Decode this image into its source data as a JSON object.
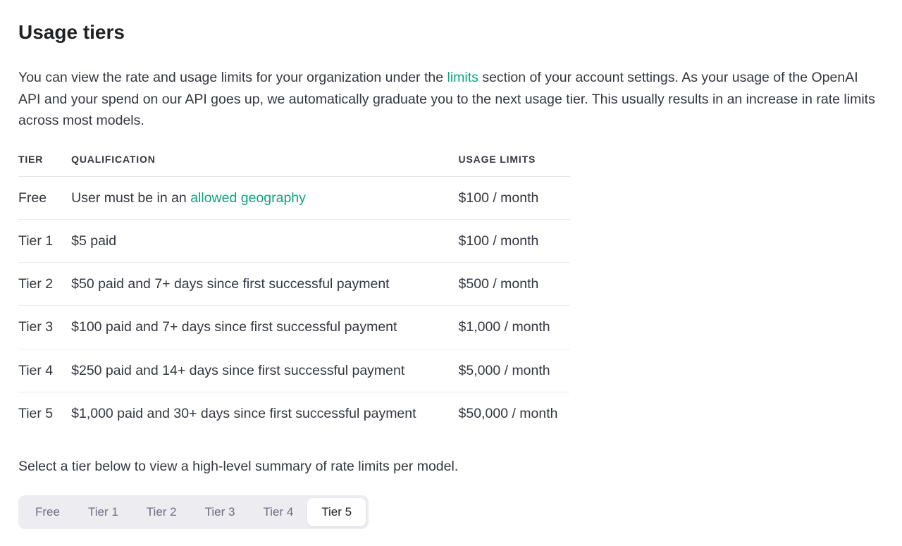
{
  "heading": "Usage tiers",
  "intro": {
    "pre_link": "You can view the rate and usage limits for your organization under the ",
    "link_text": "limits",
    "post_link": " section of your account settings. As your usage of the OpenAI API and your spend on our API goes up, we automatically graduate you to the next usage tier. This usually results in an increase in rate limits across most models."
  },
  "table": {
    "headers": {
      "tier": "TIER",
      "qualification": "QUALIFICATION",
      "usage_limits": "USAGE LIMITS"
    },
    "rows": [
      {
        "tier": "Free",
        "qualification_pre": "User must be in an ",
        "qualification_link": "allowed geography",
        "qualification_post": "",
        "usage_limits": "$100 / month"
      },
      {
        "tier": "Tier 1",
        "qualification_pre": "$5 paid",
        "qualification_link": "",
        "qualification_post": "",
        "usage_limits": "$100 / month"
      },
      {
        "tier": "Tier 2",
        "qualification_pre": "$50 paid and 7+ days since first successful payment",
        "qualification_link": "",
        "qualification_post": "",
        "usage_limits": "$500 / month"
      },
      {
        "tier": "Tier 3",
        "qualification_pre": "$100 paid and 7+ days since first successful payment",
        "qualification_link": "",
        "qualification_post": "",
        "usage_limits": "$1,000 / month"
      },
      {
        "tier": "Tier 4",
        "qualification_pre": "$250 paid and 14+ days since first successful payment",
        "qualification_link": "",
        "qualification_post": "",
        "usage_limits": "$5,000 / month"
      },
      {
        "tier": "Tier 5",
        "qualification_pre": "$1,000 paid and 30+ days since first successful payment",
        "qualification_link": "",
        "qualification_post": "",
        "usage_limits": "$50,000 / month"
      }
    ]
  },
  "select_note": "Select a tier below to view a high-level summary of rate limits per model.",
  "tabs": [
    {
      "label": "Free",
      "active": false
    },
    {
      "label": "Tier 1",
      "active": false
    },
    {
      "label": "Tier 2",
      "active": false
    },
    {
      "label": "Tier 3",
      "active": false
    },
    {
      "label": "Tier 4",
      "active": false
    },
    {
      "label": "Tier 5",
      "active": true
    }
  ]
}
